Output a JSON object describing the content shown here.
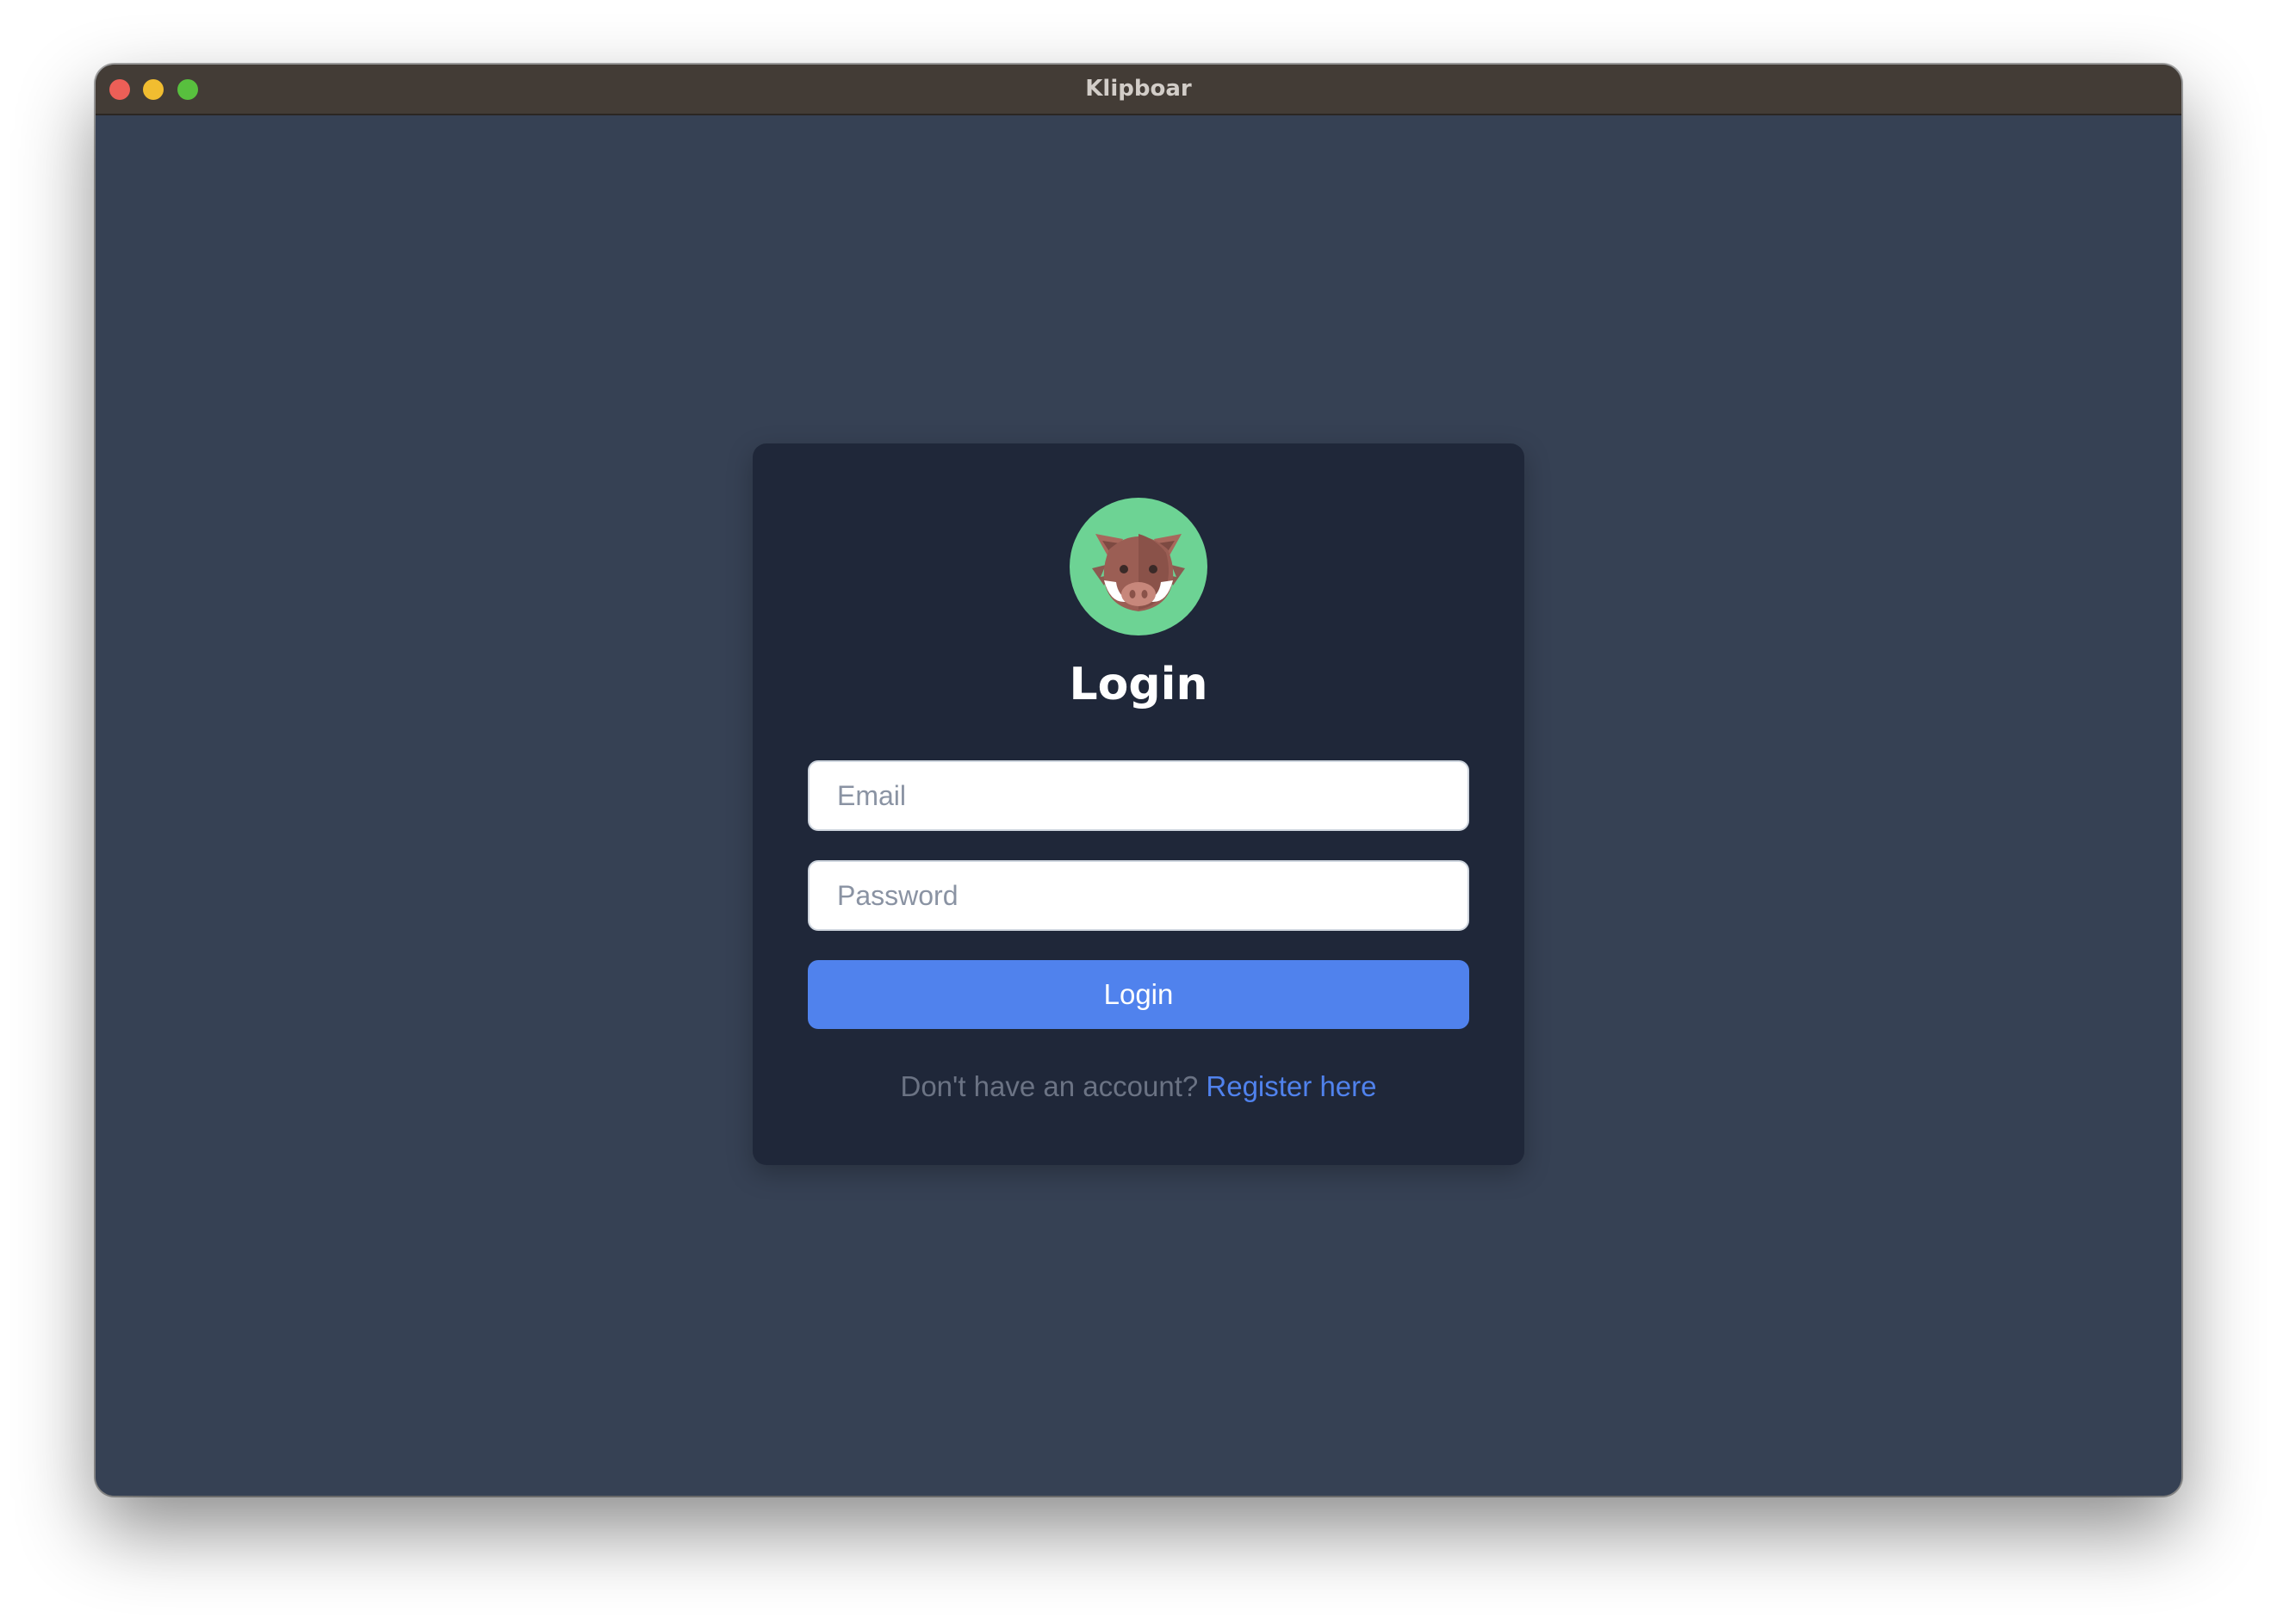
{
  "window": {
    "title": "Klipboar"
  },
  "login_card": {
    "logo_icon": "boar-icon",
    "title": "Login",
    "email_placeholder": "Email",
    "email_value": "",
    "password_placeholder": "Password",
    "password_value": "",
    "submit_label": "Login",
    "footer_prompt": "Don't have an account?",
    "register_link": "Register here"
  },
  "colors": {
    "window_background": "#364154",
    "card_background": "#1f2739",
    "titlebar": "#433c36",
    "accent": "#5082ed",
    "logo_circle": "#6dd394"
  }
}
